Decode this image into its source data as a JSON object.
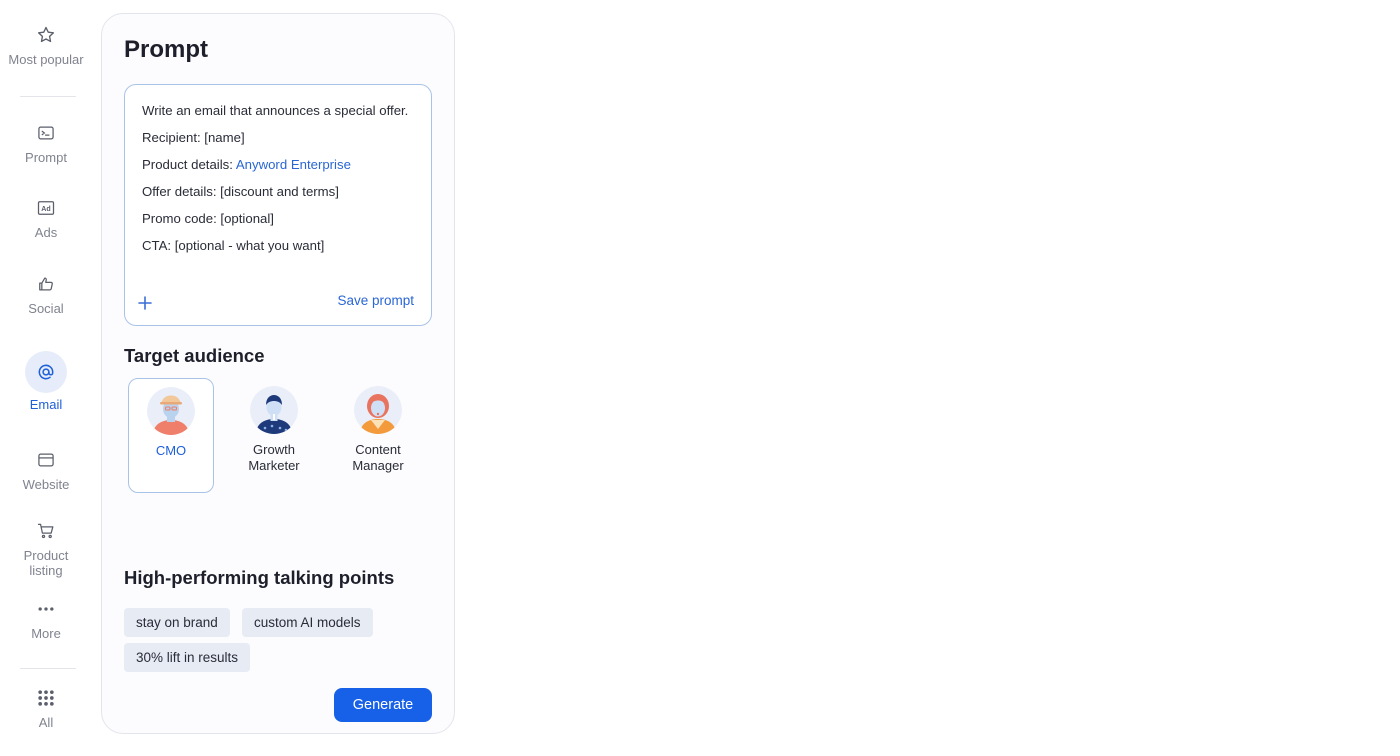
{
  "sidebar": {
    "items": [
      {
        "label": "Most popular",
        "icon": "star-icon"
      },
      {
        "label": "Prompt",
        "icon": "terminal-icon"
      },
      {
        "label": "Ads",
        "icon": "ad-icon"
      },
      {
        "label": "Social",
        "icon": "thumbs-up-icon"
      },
      {
        "label": "Email",
        "icon": "at-sign-icon",
        "active": true
      },
      {
        "label": "Website",
        "icon": "browser-window-icon"
      },
      {
        "label": "Product listing",
        "icon": "cart-icon"
      },
      {
        "label": "More",
        "icon": "more-dots-icon"
      },
      {
        "label": "All",
        "icon": "grid-icon"
      }
    ]
  },
  "panel": {
    "title": "Prompt",
    "prompt": {
      "lines": [
        "Write an email that announces a special offer.",
        "Recipient: [name]",
        "Product details: ",
        "Offer details: [discount and terms]",
        "Promo code: [optional]",
        "CTA: [optional - what you want]"
      ],
      "product_value": "Anyword Enterprise",
      "save_label": "Save prompt"
    },
    "audience": {
      "title": "Target audience",
      "personas": [
        {
          "label": "CMO",
          "selected": true
        },
        {
          "label": "Growth Marketer",
          "selected": false
        },
        {
          "label": "Content Manager",
          "selected": false
        }
      ]
    },
    "talking_points": {
      "title": "High-performing talking points",
      "chips": [
        "stay on brand",
        "custom AI models",
        "30% lift in results"
      ]
    },
    "generate_label": "Generate"
  },
  "colors": {
    "accent": "#1760e8",
    "link": "#2a66d4",
    "chip_bg": "#e7ebf4",
    "selected_border": "#a9c3e8"
  }
}
